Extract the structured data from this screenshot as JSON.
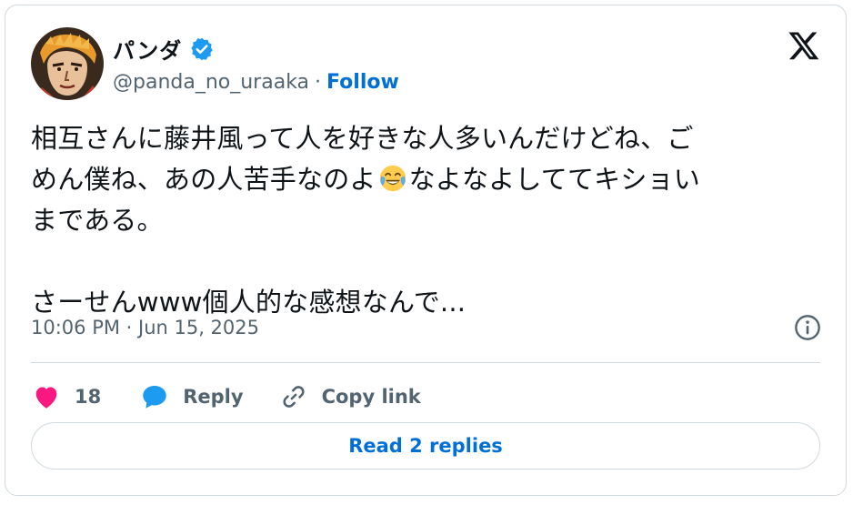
{
  "author": {
    "display_name": "パンダ",
    "handle": "@panda_no_uraaka",
    "separator": "·",
    "follow_label": "Follow",
    "verified": true
  },
  "tweet": {
    "lines": [
      "相互さんに藤井風って人を好きな人多いんだけどね、ご",
      "めん僕ね、あの人苦手なのよ",
      "なよなよしててキショい",
      "まである。",
      "さーせんwww個人的な感想なんで..."
    ],
    "timestamp": "10:06 PM · Jun 15, 2025"
  },
  "actions": {
    "like_count": "18",
    "reply_label": "Reply",
    "copy_link_label": "Copy link"
  },
  "read_replies_label": "Read 2 replies",
  "icons": {
    "logo": "x-logo-icon",
    "verified": "verified-badge-icon",
    "emoji": "face-with-tears-of-joy-emoji",
    "info": "info-icon",
    "like": "heart-icon",
    "reply": "speech-bubble-icon",
    "copy": "link-icon"
  },
  "colors": {
    "link_blue": "#006fd6",
    "verified_blue": "#1d9bf0",
    "heart": "#f91880",
    "secondary_text": "#536471",
    "border": "#cfd9de"
  }
}
